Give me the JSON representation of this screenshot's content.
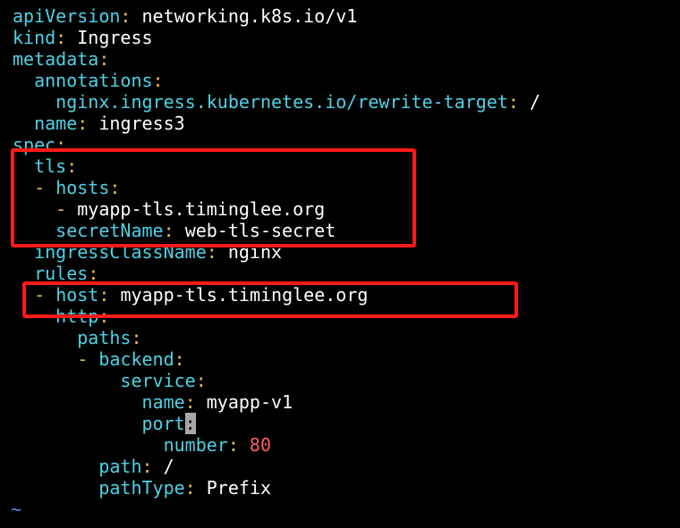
{
  "editor": {
    "lines": [
      {
        "indent": "",
        "key": "apiVersion",
        "value": "networking.k8s.io/v1"
      },
      {
        "indent": "",
        "key": "kind",
        "value": "Ingress"
      },
      {
        "indent": "",
        "key": "metadata",
        "value": ""
      },
      {
        "indent": "  ",
        "key": "annotations",
        "value": ""
      },
      {
        "indent": "    ",
        "key": "nginx.ingress.kubernetes.io/rewrite-target",
        "value": "/"
      },
      {
        "indent": "  ",
        "key": "name",
        "value": "ingress3"
      },
      {
        "indent": "",
        "key": "spec",
        "value": ""
      },
      {
        "indent": "  ",
        "key": "tls",
        "value": ""
      },
      {
        "indent": "  ",
        "dash": "- ",
        "key": "hosts",
        "value": ""
      },
      {
        "indent": "    ",
        "dash": "- ",
        "key": "",
        "value": "myapp-tls.timinglee.org"
      },
      {
        "indent": "    ",
        "key": "secretName",
        "value": "web-tls-secret"
      },
      {
        "indent": "  ",
        "key": "ingressClassName",
        "value": "nginx"
      },
      {
        "indent": "  ",
        "key": "rules",
        "value": ""
      },
      {
        "indent": "  ",
        "dash": "- ",
        "key": "host",
        "value": "myapp-tls.timinglee.org"
      },
      {
        "indent": "    ",
        "key": "http",
        "value": ""
      },
      {
        "indent": "      ",
        "key": "paths",
        "value": ""
      },
      {
        "indent": "      ",
        "dash": "- ",
        "key": "backend",
        "value": ""
      },
      {
        "indent": "          ",
        "key": "service",
        "value": ""
      },
      {
        "indent": "            ",
        "key": "name",
        "value": "myapp-v1"
      },
      {
        "indent": "            ",
        "key": "port",
        "value": "",
        "cursor": true
      },
      {
        "indent": "              ",
        "key": "number",
        "value": "80",
        "numeric": true
      },
      {
        "indent": "        ",
        "key": "path",
        "value": "/"
      },
      {
        "indent": "        ",
        "key": "pathType",
        "value": "Prefix"
      }
    ],
    "empty_line_marker": "~"
  },
  "colors": {
    "key": "#4fd2e5",
    "punctuation": "#e5c04f",
    "number": "#ff5f5f",
    "highlight_box": "#ff1a1a",
    "background": "#000000"
  }
}
